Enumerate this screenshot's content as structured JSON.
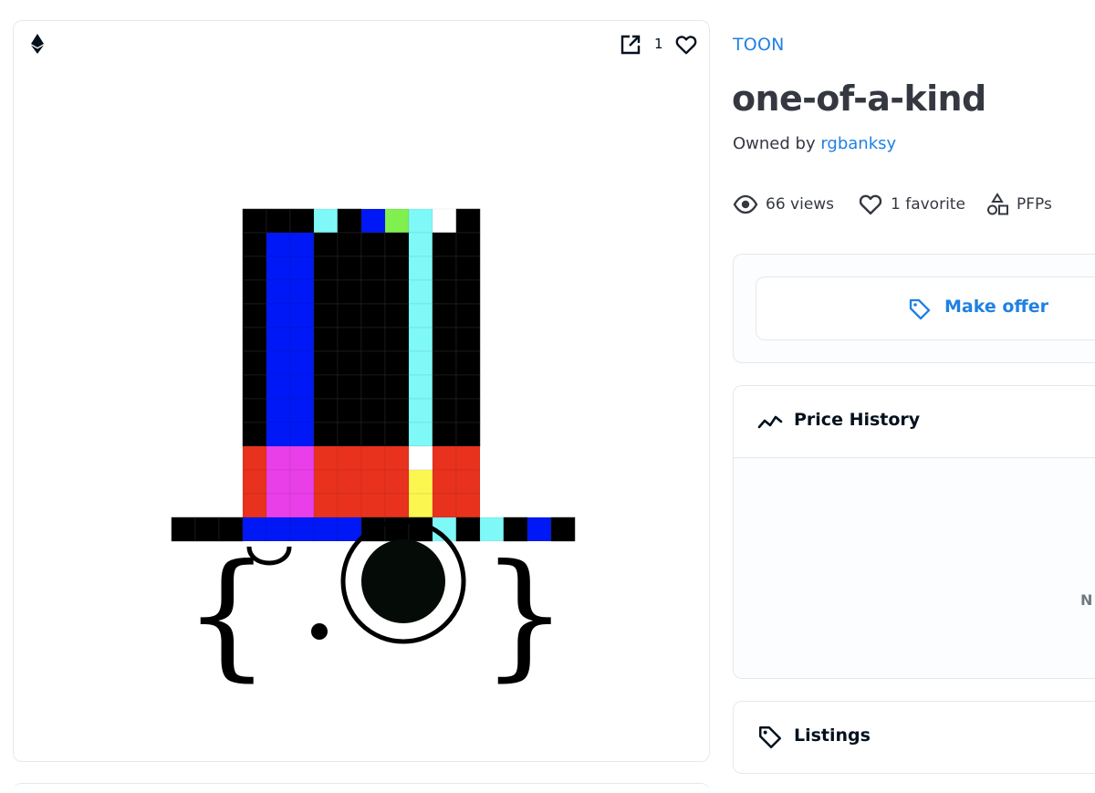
{
  "toolbar": {
    "favorite_count": "1"
  },
  "collection": {
    "name": "TOON"
  },
  "nft": {
    "title": "one-of-a-kind",
    "owned_by_label": "Owned by",
    "owner": "rgbanksy"
  },
  "stats": {
    "views": "66 views",
    "favorites": "1 favorite",
    "category": "PFPs"
  },
  "offer": {
    "button_label": "Make offer"
  },
  "price_history": {
    "title": "Price History",
    "empty_text_visible": "N"
  },
  "listings": {
    "title": "Listings"
  },
  "colors": {
    "accent": "#2081e2",
    "text": "#353840",
    "border": "#e5e8eb",
    "hat_black": "#000000",
    "hat_blue": "#0018f5",
    "hat_cyan": "#7ff8f8",
    "hat_green": "#7ff04e",
    "hat_red": "#e8321e",
    "hat_magenta": "#e83fe8",
    "hat_yellow": "#fbf650",
    "hat_white": "#ffffff"
  },
  "icons": {
    "chain": "ethereum-icon",
    "external": "external-link-icon",
    "favorite": "heart-icon",
    "views": "eye-icon",
    "category": "shapes-icon",
    "offer": "tag-icon",
    "history": "trend-line-icon",
    "listings": "tag-icon"
  }
}
